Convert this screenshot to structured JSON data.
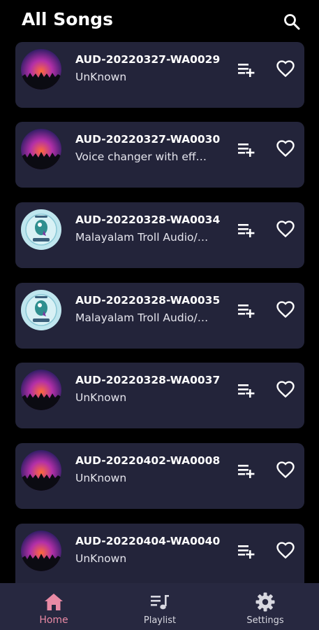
{
  "header": {
    "title": "All Songs",
    "search_icon": "search-icon"
  },
  "songs": [
    {
      "title": "AUD-20220327-WA0029",
      "artist": "UnKnown",
      "art": "concert"
    },
    {
      "title": "AUD-20220327-WA0030",
      "artist": "Voice changer with effects",
      "art": "concert"
    },
    {
      "title": "AUD-20220328-WA0034",
      "artist": "Malayalam Troll Audio/Memes",
      "art": "troll-logo"
    },
    {
      "title": "AUD-20220328-WA0035",
      "artist": "Malayalam Troll Audio/Memes",
      "art": "troll-logo"
    },
    {
      "title": "AUD-20220328-WA0037",
      "artist": "UnKnown",
      "art": "concert"
    },
    {
      "title": "AUD-20220402-WA0008",
      "artist": "UnKnown",
      "art": "concert"
    },
    {
      "title": "AUD-20220404-WA0040",
      "artist": "UnKnown",
      "art": "concert"
    }
  ],
  "song_actions": {
    "add_icon": "playlist-add-icon",
    "fav_icon": "heart-outline-icon"
  },
  "bottom_nav": [
    {
      "label": "Home",
      "icon": "home-icon",
      "active": true
    },
    {
      "label": "Playlist",
      "icon": "playlist-icon",
      "active": false
    },
    {
      "label": "Settings",
      "icon": "gear-icon",
      "active": false
    }
  ],
  "colors": {
    "background": "#000000",
    "card": "#23243a",
    "nav_bar": "#272840",
    "active_accent": "#e98aa5",
    "text": "#ffffff"
  }
}
